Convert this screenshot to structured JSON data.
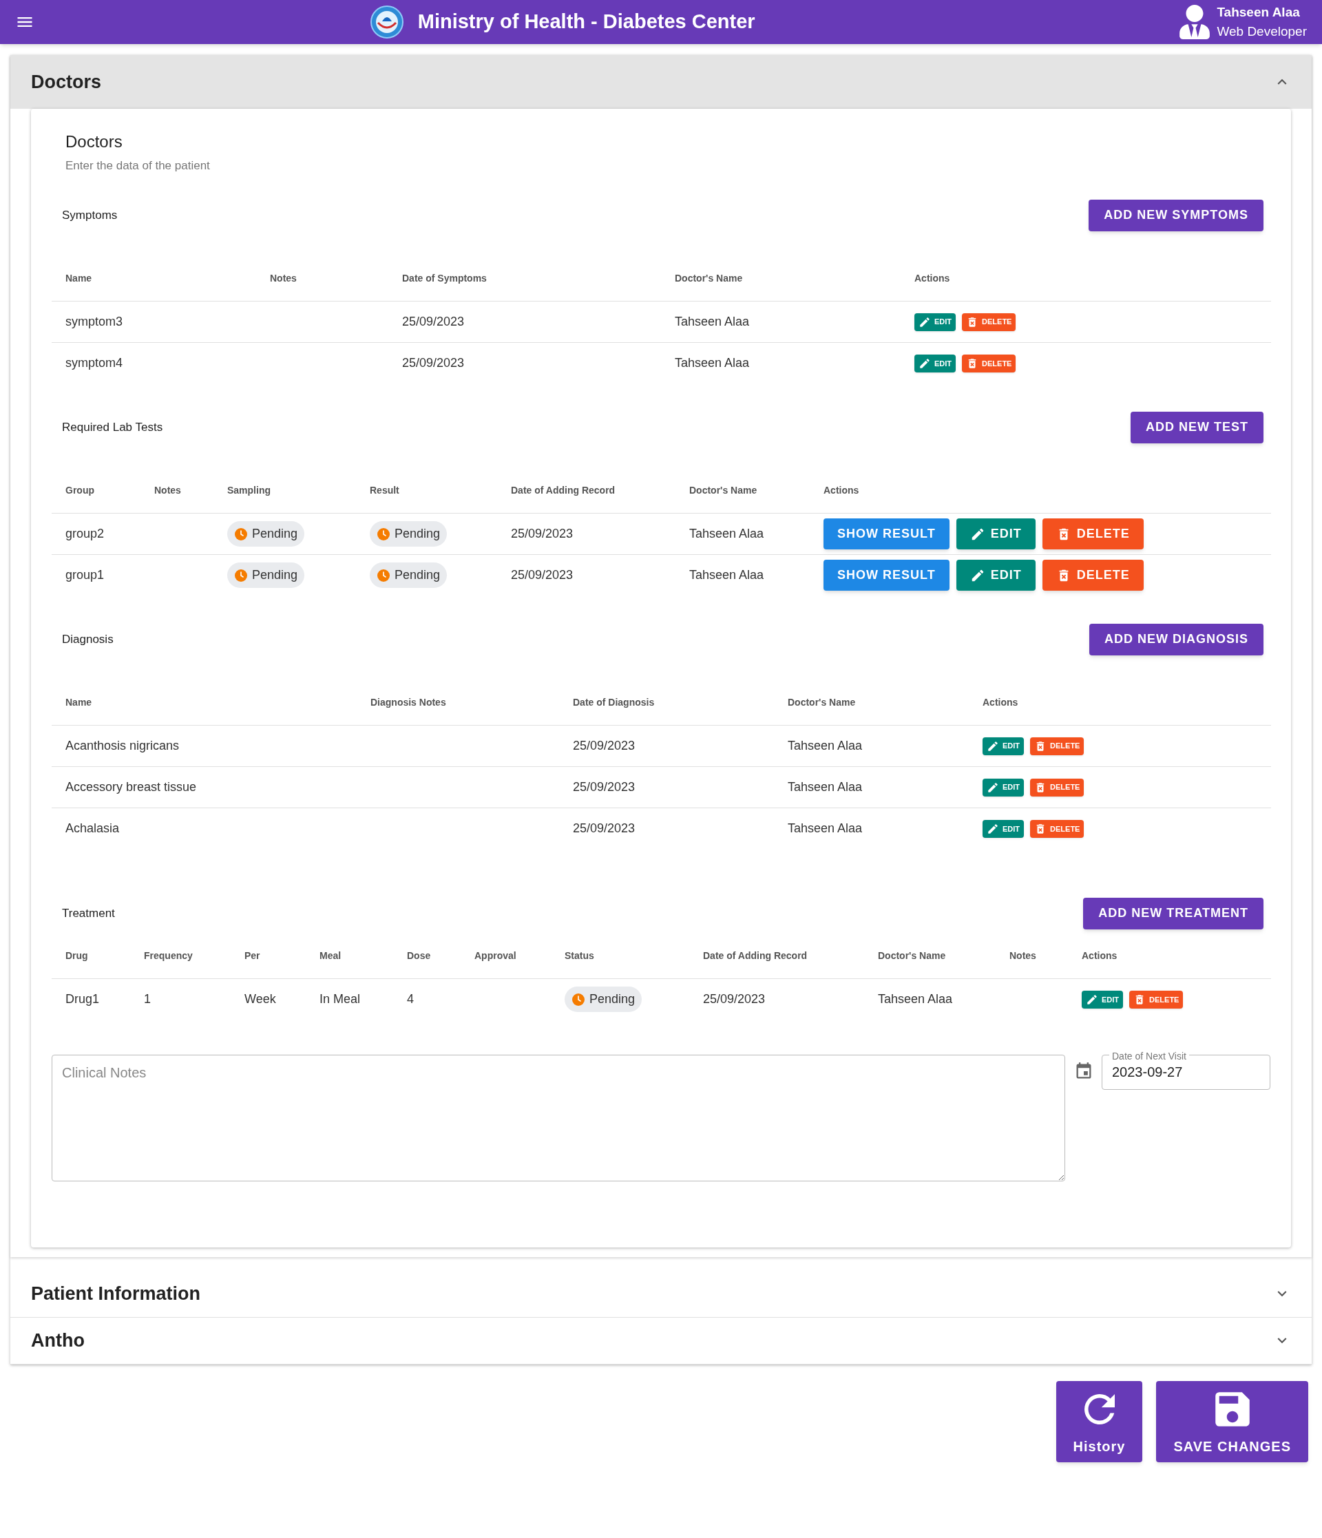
{
  "app_bar": {
    "title": "Ministry of Health - Diabetes Center",
    "user": {
      "name": "Tahseen Alaa",
      "role": "Web Developer"
    }
  },
  "accordions": [
    {
      "title": "Doctors",
      "expanded": true,
      "content": {
        "title": "Doctors",
        "subtitle": "Enter the data of the patient",
        "sections": [
          {
            "kind": "symptoms",
            "title": "Symptoms",
            "button": "ADD NEW SYMPTOMS",
            "columns": [
              {
                "label": "Name"
              },
              {
                "label": "Notes"
              },
              {
                "label": "Date of Symptoms"
              },
              {
                "label": "Doctor's Name"
              },
              {
                "label": "Actions",
                "kind": "actions"
              }
            ],
            "rows": [
              {
                "cells": [
                  "symptom3",
                  "",
                  "25/09/2023",
                  "Tahseen Alaa"
                ],
                "actions": [
                  {
                    "label": "EDIT",
                    "kind": "edit"
                  },
                  {
                    "label": "DELETE",
                    "kind": "delete"
                  }
                ]
              },
              {
                "cells": [
                  "symptom4",
                  "",
                  "25/09/2023",
                  "Tahseen Alaa"
                ],
                "actions": [
                  {
                    "label": "EDIT",
                    "kind": "edit"
                  },
                  {
                    "label": "DELETE",
                    "kind": "delete"
                  }
                ]
              }
            ]
          },
          {
            "kind": "lab_tests",
            "title": "Required Lab Tests",
            "button": "ADD NEW TEST",
            "columns": [
              {
                "label": "Group"
              },
              {
                "label": "Notes"
              },
              {
                "label": "Sampling",
                "kind": "status"
              },
              {
                "label": "Result",
                "kind": "status"
              },
              {
                "label": "Date of Adding Record"
              },
              {
                "label": "Doctor's Name"
              },
              {
                "label": "Actions",
                "kind": "actions"
              }
            ],
            "rows": [
              {
                "cells": [
                  "group2",
                  "",
                  "Pending",
                  "Pending",
                  "25/09/2023",
                  "Tahseen Alaa"
                ],
                "actions": [
                  {
                    "label": "SHOW RESULT",
                    "kind": "show_result"
                  },
                  {
                    "label": "EDIT",
                    "kind": "edit"
                  },
                  {
                    "label": "DELETE",
                    "kind": "delete"
                  }
                ]
              },
              {
                "cells": [
                  "group1",
                  "",
                  "Pending",
                  "Pending",
                  "25/09/2023",
                  "Tahseen Alaa"
                ],
                "actions": [
                  {
                    "label": "SHOW RESULT",
                    "kind": "show_result"
                  },
                  {
                    "label": "EDIT",
                    "kind": "edit"
                  },
                  {
                    "label": "DELETE",
                    "kind": "delete"
                  }
                ]
              }
            ]
          },
          {
            "kind": "diagnosis",
            "title": "Diagnosis",
            "button": "ADD NEW DIAGNOSIS",
            "columns": [
              {
                "label": "Name"
              },
              {
                "label": "Diagnosis Notes"
              },
              {
                "label": "Date of Diagnosis"
              },
              {
                "label": "Doctor's Name"
              },
              {
                "label": "Actions",
                "kind": "actions"
              }
            ],
            "rows": [
              {
                "cells": [
                  "Acanthosis nigricans",
                  "",
                  "25/09/2023",
                  "Tahseen Alaa"
                ],
                "actions": [
                  {
                    "label": "EDIT",
                    "kind": "edit"
                  },
                  {
                    "label": "DELETE",
                    "kind": "delete"
                  }
                ]
              },
              {
                "cells": [
                  "Accessory breast tissue",
                  "",
                  "25/09/2023",
                  "Tahseen Alaa"
                ],
                "actions": [
                  {
                    "label": "EDIT",
                    "kind": "edit"
                  },
                  {
                    "label": "DELETE",
                    "kind": "delete"
                  }
                ]
              },
              {
                "cells": [
                  "Achalasia",
                  "",
                  "25/09/2023",
                  "Tahseen Alaa"
                ],
                "actions": [
                  {
                    "label": "EDIT",
                    "kind": "edit"
                  },
                  {
                    "label": "DELETE",
                    "kind": "delete"
                  }
                ]
              }
            ]
          },
          {
            "kind": "treatment",
            "title": "Treatment",
            "button": "ADD NEW TREATMENT",
            "columns": [
              {
                "label": "Drug"
              },
              {
                "label": "Frequency"
              },
              {
                "label": "Per"
              },
              {
                "label": "Meal"
              },
              {
                "label": "Dose"
              },
              {
                "label": "Approval"
              },
              {
                "label": "Status",
                "kind": "status"
              },
              {
                "label": "Date of Adding Record"
              },
              {
                "label": "Doctor's Name"
              },
              {
                "label": "Notes"
              },
              {
                "label": "Actions",
                "kind": "actions"
              }
            ],
            "rows": [
              {
                "cells": [
                  "Drug1",
                  "1",
                  "Week",
                  "In Meal",
                  "4",
                  "",
                  "Pending",
                  "25/09/2023",
                  "Tahseen Alaa",
                  ""
                ],
                "actions": [
                  {
                    "label": "EDIT",
                    "kind": "edit"
                  },
                  {
                    "label": "DELETE",
                    "kind": "delete"
                  }
                ]
              }
            ]
          }
        ],
        "clinical_notes": {
          "placeholder": "Clinical Notes"
        },
        "next_visit": {
          "label": "Date of Next Visit",
          "value": "2023-09-27"
        }
      }
    },
    {
      "title": "Patient Information",
      "expanded": false
    },
    {
      "title": "Antho",
      "expanded": false
    }
  ],
  "footer_buttons": [
    {
      "label": "History",
      "kind": "history"
    },
    {
      "label": "SAVE CHANGES",
      "kind": "save"
    }
  ]
}
